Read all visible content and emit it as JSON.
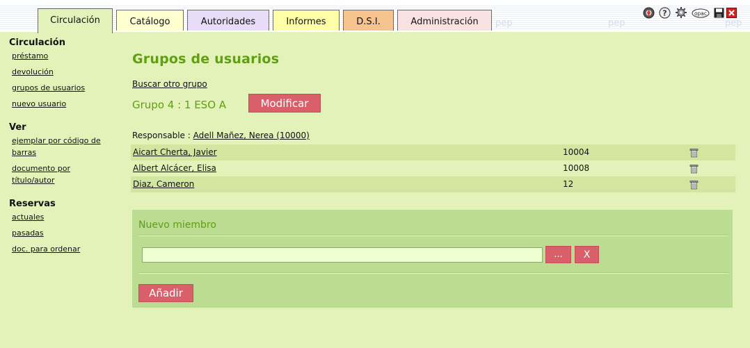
{
  "tabs": [
    {
      "label": "Circulación",
      "color": "#e2f2b8",
      "active": true
    },
    {
      "label": "Catálogo",
      "color": "#ffffd0"
    },
    {
      "label": "Autoridades",
      "color": "#e8dcf8"
    },
    {
      "label": "Informes",
      "color": "#ffffa8"
    },
    {
      "label": "D.S.I.",
      "color": "#f6c28e"
    },
    {
      "label": "Administración",
      "color": "#fbe2e2"
    }
  ],
  "watermarks": [
    "pep",
    "pep",
    "pep"
  ],
  "header_icons": [
    "home-icon",
    "help-icon",
    "settings-icon",
    "opac-icon",
    "save-icon",
    "close-icon"
  ],
  "header_icon_text": {
    "opac": "opac"
  },
  "sidebar": {
    "sections": [
      {
        "heading": "Circulación",
        "links": [
          "préstamo",
          "devolución",
          "grupos de usuarios",
          "nuevo usuario"
        ]
      },
      {
        "heading": "Ver",
        "links": [
          "ejemplar por código de barras",
          "documento por título/autor"
        ]
      },
      {
        "heading": "Reservas",
        "links": [
          "actuales",
          "pasadas",
          "doc. para ordenar"
        ]
      }
    ]
  },
  "main": {
    "title": "Grupos de usuarios",
    "search_other_link": "Buscar otro grupo",
    "group_label": "Grupo 4 : 1 ESO A",
    "modify_button": "Modificar",
    "responsible_label": "Responsable :",
    "responsible_name": "Adell Mañez, Nerea (10000)",
    "members": [
      {
        "name": "Aicart Cherta, Javier",
        "code": "10004"
      },
      {
        "name": "Albert Alcácer, Elisa",
        "code": "10008"
      },
      {
        "name": "Diaz, Cameron",
        "code": "12"
      }
    ]
  },
  "new_member": {
    "title": "Nuevo miembro",
    "input_value": "",
    "browse_button": "...",
    "clear_button": "X",
    "add_button": "Añadir"
  },
  "colors": {
    "accent_green": "#5f9f10",
    "background": "#e2f2b8",
    "row_alt": "#d3e69f",
    "panel": "#bcdc92",
    "button_red": "#d9606a"
  }
}
